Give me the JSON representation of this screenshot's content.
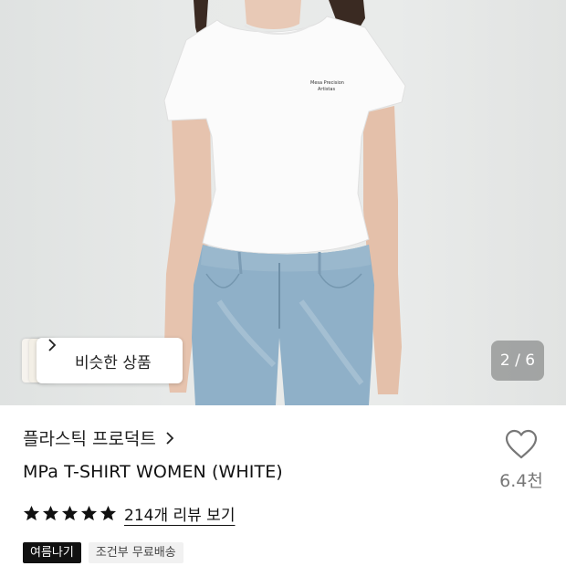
{
  "product_image": {
    "page_counter": "2 / 6",
    "similar_products_label": "비슷한 상품",
    "shirt_print_line1": "Mesa Precision",
    "shirt_print_line2": "Artistas"
  },
  "product": {
    "brand": "플라스틱 프로덕트",
    "title": "MPa T-SHIRT WOMEN (WHITE)",
    "likes": "6.4천",
    "rating_stars": 5,
    "review_link": "214개 리뷰 보기",
    "tags": [
      {
        "label": "여름나기",
        "style": "dark"
      },
      {
        "label": "조건부 무료배송",
        "style": "light"
      }
    ]
  },
  "colors": {
    "tag_dark": "#111111",
    "tag_light": "#f1f1f1",
    "counter_bg": "rgba(110,112,112,0.55)"
  },
  "icons": [
    "chevron-right-icon",
    "heart-icon",
    "star-icon"
  ]
}
